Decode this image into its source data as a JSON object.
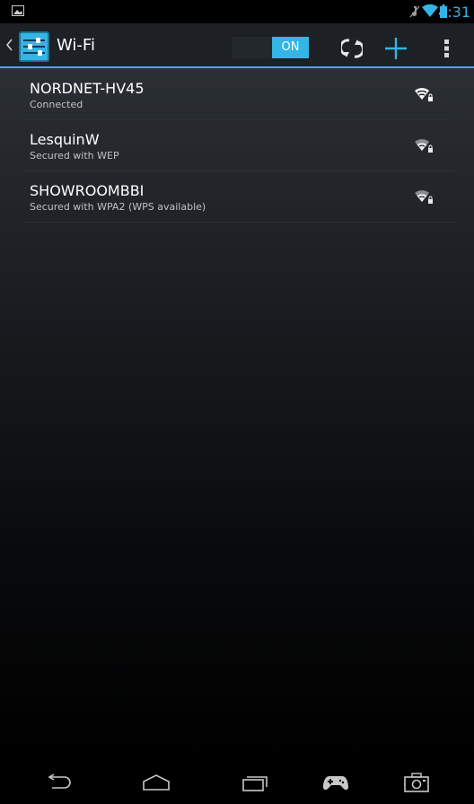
{
  "status_bar": {
    "time": "4:31",
    "icons": [
      "picture-icon",
      "mute-icon",
      "wifi-status-icon",
      "battery-icon"
    ]
  },
  "action_bar": {
    "title": "Wi-Fi",
    "toggle_label": "ON",
    "accent_color": "#33b5e5",
    "actions": [
      "wps-icon",
      "add-icon",
      "overflow-menu-icon"
    ]
  },
  "networks": [
    {
      "name": "NORDNET-HV45",
      "status": "Connected",
      "signal_icon": "wifi-locked-icon",
      "active": true
    },
    {
      "name": "LesquinW",
      "status": "Secured with WEP",
      "signal_icon": "wifi-locked-icon",
      "active": false
    },
    {
      "name": "SHOWROOMBBI",
      "status": "Secured with WPA2 (WPS available)",
      "signal_icon": "wifi-locked-icon",
      "active": false
    }
  ],
  "nav_bar": {
    "buttons": [
      "back-icon",
      "home-icon",
      "recents-icon",
      "gamepad-icon",
      "camera-icon"
    ]
  }
}
